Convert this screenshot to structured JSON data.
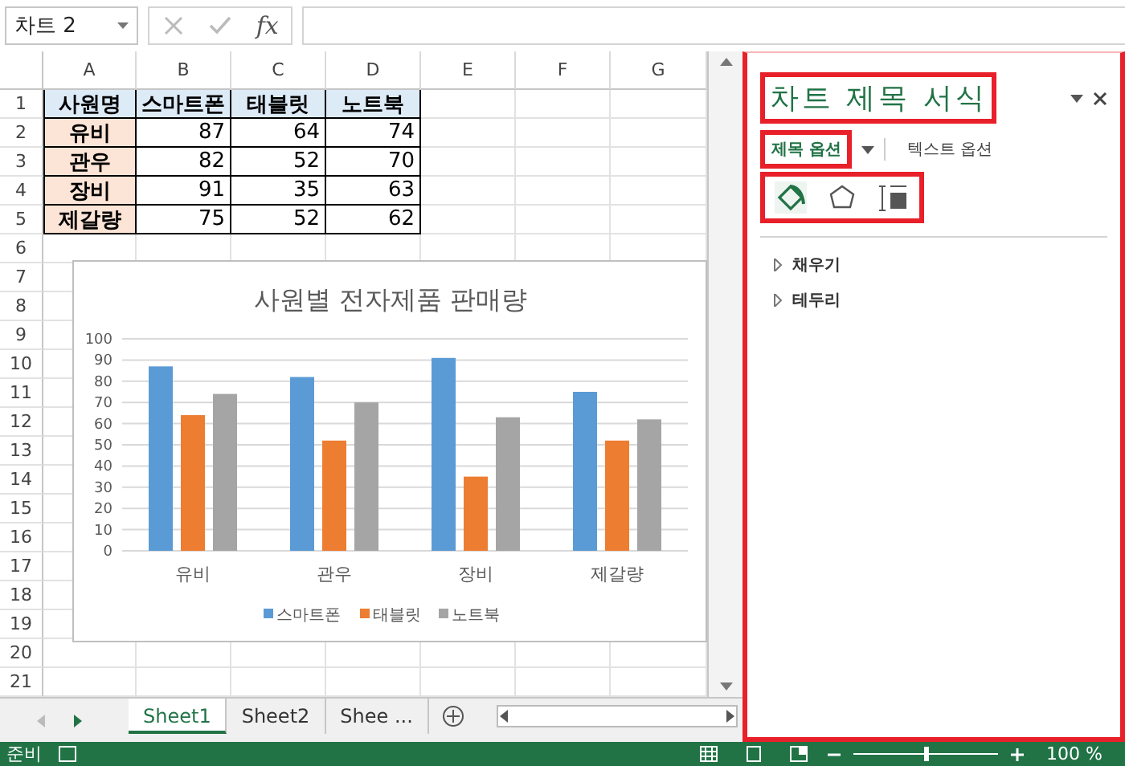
{
  "name_box": {
    "value": "차트 2"
  },
  "formula_bar": {
    "function_label": "fx"
  },
  "columns": [
    "A",
    "B",
    "C",
    "D",
    "E",
    "F",
    "G"
  ],
  "rows": [
    {
      "number": "1",
      "kind": "header",
      "cells": [
        "사원명",
        "스마트폰",
        "태블릿",
        "노트북"
      ]
    },
    {
      "number": "2",
      "kind": "data",
      "cells": [
        "유비",
        "87",
        "64",
        "74"
      ]
    },
    {
      "number": "3",
      "kind": "data",
      "cells": [
        "관우",
        "82",
        "52",
        "70"
      ]
    },
    {
      "number": "4",
      "kind": "data",
      "cells": [
        "장비",
        "91",
        "35",
        "63"
      ]
    },
    {
      "number": "5",
      "kind": "data",
      "cells": [
        "제갈량",
        "75",
        "52",
        "62"
      ]
    },
    {
      "number": "6"
    },
    {
      "number": "7"
    },
    {
      "number": "8"
    },
    {
      "number": "9"
    },
    {
      "number": "10"
    },
    {
      "number": "11"
    },
    {
      "number": "12"
    },
    {
      "number": "13"
    },
    {
      "number": "14"
    },
    {
      "number": "15"
    },
    {
      "number": "16"
    },
    {
      "number": "17"
    },
    {
      "number": "18"
    },
    {
      "number": "19"
    },
    {
      "number": "20"
    },
    {
      "number": "21"
    }
  ],
  "chart": {
    "chart_data": {
      "type": "bar",
      "grid": true,
      "legend": true,
      "title": "사원별 전자제품 판매량",
      "categories": [
        "유비",
        "관우",
        "장비",
        "제갈량"
      ],
      "ylim": [
        0,
        100
      ],
      "yticks": [
        0,
        10,
        20,
        30,
        40,
        50,
        60,
        70,
        80,
        90,
        100
      ],
      "series": [
        {
          "name": "스마트폰",
          "color": "#5b9bd5",
          "values": [
            87,
            82,
            91,
            75
          ]
        },
        {
          "name": "태블릿",
          "color": "#ed7d31",
          "values": [
            64,
            52,
            35,
            52
          ]
        },
        {
          "name": "노트북",
          "color": "#a5a5a5",
          "values": [
            74,
            70,
            63,
            62
          ]
        }
      ]
    }
  },
  "sheet_tabs": [
    {
      "label": "Sheet1",
      "selected": true
    },
    {
      "label": "Sheet2",
      "selected": false
    },
    {
      "label": "Shee ...",
      "selected": false
    }
  ],
  "format_pane": {
    "highlighted": true,
    "title": {
      "text": "차트 제목 서식",
      "highlighted": true
    },
    "tabs": [
      {
        "label": "제목 옵션",
        "selected": true,
        "highlighted": true
      },
      {
        "label": "텍스트 옵션",
        "selected": false,
        "highlighted": false
      }
    ],
    "icon_tabs": {
      "highlighted": true,
      "items": [
        {
          "kind": "fill",
          "selected": true
        },
        {
          "kind": "shape",
          "selected": false
        },
        {
          "kind": "size",
          "selected": false
        }
      ]
    },
    "sections": [
      {
        "label": "채우기",
        "expanded": false
      },
      {
        "label": "테두리",
        "expanded": false
      }
    ]
  },
  "status_bar": {
    "ready": "준비",
    "zoom_slider": {
      "level": 0.5
    },
    "zoom": "100 %"
  }
}
